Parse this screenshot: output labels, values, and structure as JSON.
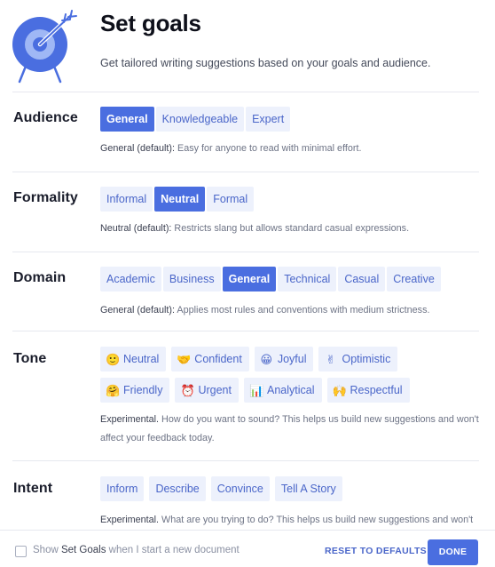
{
  "header": {
    "title": "Set goals",
    "subtitle": "Get tailored writing suggestions based on your goals and audience.",
    "logo_icon": "target-with-arrow-icon"
  },
  "audience": {
    "label": "Audience",
    "options": [
      "General",
      "Knowledgeable",
      "Expert"
    ],
    "selected": "General",
    "desc_strong": "General (default):",
    "desc_text": " Easy for anyone to read with minimal effort."
  },
  "formality": {
    "label": "Formality",
    "options": [
      "Informal",
      "Neutral",
      "Formal"
    ],
    "selected": "Neutral",
    "desc_strong": "Neutral (default):",
    "desc_text": " Restricts slang but allows standard casual expressions."
  },
  "domain": {
    "label": "Domain",
    "options": [
      "Academic",
      "Business",
      "General",
      "Technical",
      "Casual",
      "Creative"
    ],
    "selected": "General",
    "desc_strong": "General (default):",
    "desc_text": " Applies most rules and conventions with medium strictness."
  },
  "tone": {
    "label": "Tone",
    "options": [
      {
        "label": "Neutral",
        "emoji": "🙂",
        "icon": "neutral-face-icon"
      },
      {
        "label": "Confident",
        "emoji": "🤝",
        "icon": "handshake-icon"
      },
      {
        "label": "Joyful",
        "emoji": "😀",
        "icon": "grinning-face-icon"
      },
      {
        "label": "Optimistic",
        "emoji": "✌",
        "icon": "victory-hand-icon"
      },
      {
        "label": "Friendly",
        "emoji": "🤗",
        "icon": "hugging-face-icon"
      },
      {
        "label": "Urgent",
        "emoji": "⏰",
        "icon": "alarm-clock-icon"
      },
      {
        "label": "Analytical",
        "emoji": "📊",
        "icon": "bar-chart-icon"
      },
      {
        "label": "Respectful",
        "emoji": "🙌",
        "icon": "raised-hands-icon"
      }
    ],
    "desc_strong": "Experimental.",
    "desc_text": " How do you want to sound? This helps us build new suggestions and won't affect your feedback today."
  },
  "intent": {
    "label": "Intent",
    "options": [
      "Inform",
      "Describe",
      "Convince",
      "Tell A Story"
    ],
    "desc_strong": "Experimental.",
    "desc_text": " What are you trying to do? This helps us build new suggestions and won't"
  },
  "footer": {
    "checkbox_prefix": "Show ",
    "checkbox_emphasis": "Set Goals",
    "checkbox_suffix": " when I start a new document",
    "checkbox_checked": false,
    "reset_label": "RESET TO DEFAULTS",
    "done_label": "DONE"
  },
  "colors": {
    "accent": "#4a6ee0",
    "chip_bg": "#edf1fc",
    "chip_text": "#4a66c9"
  }
}
